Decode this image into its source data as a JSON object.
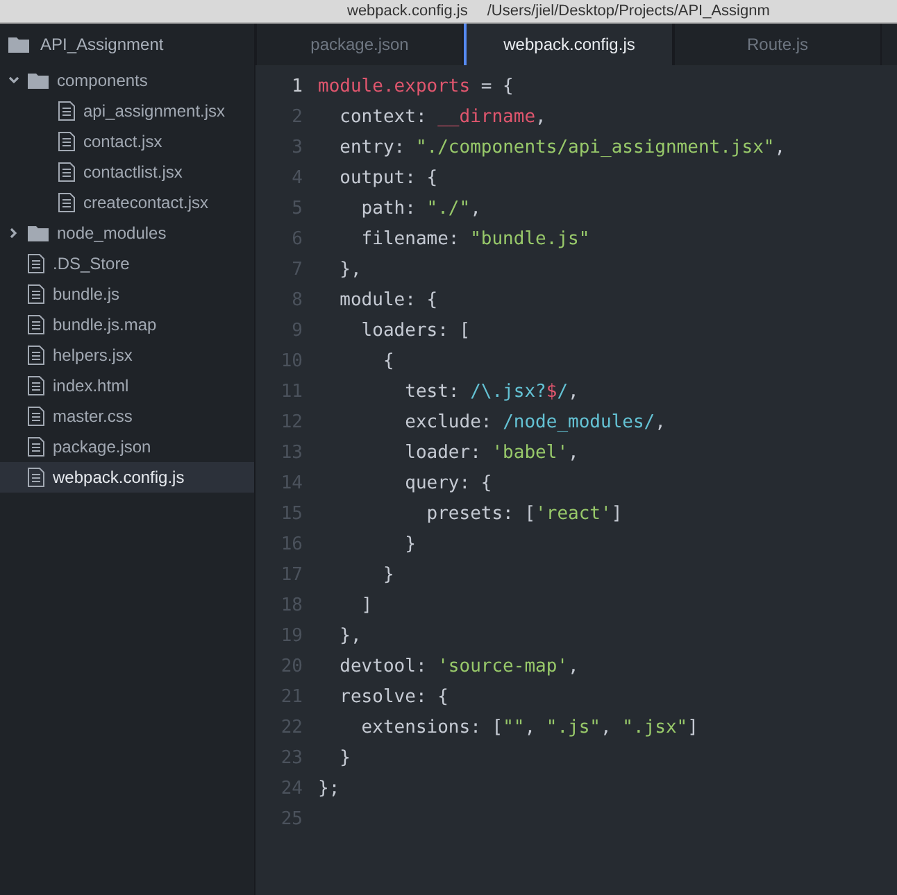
{
  "window": {
    "title": "webpack.config.js",
    "path": "/Users/jiel/Desktop/Projects/API_Assignm"
  },
  "sidebar": {
    "root": "API_Assignment",
    "items": [
      {
        "name": "components",
        "kind": "folder",
        "expanded": true,
        "selected": false,
        "children": [
          {
            "name": "api_assignment.jsx",
            "kind": "file",
            "selected": false
          },
          {
            "name": "contact.jsx",
            "kind": "file",
            "selected": false
          },
          {
            "name": "contactlist.jsx",
            "kind": "file",
            "selected": false
          },
          {
            "name": "createcontact.jsx",
            "kind": "file",
            "selected": false
          }
        ]
      },
      {
        "name": "node_modules",
        "kind": "folder",
        "expanded": false,
        "selected": false
      },
      {
        "name": ".DS_Store",
        "kind": "file",
        "selected": false
      },
      {
        "name": "bundle.js",
        "kind": "file",
        "selected": false
      },
      {
        "name": "bundle.js.map",
        "kind": "file",
        "selected": false
      },
      {
        "name": "helpers.jsx",
        "kind": "file",
        "selected": false
      },
      {
        "name": "index.html",
        "kind": "file",
        "selected": false
      },
      {
        "name": "master.css",
        "kind": "file",
        "selected": false
      },
      {
        "name": "package.json",
        "kind": "file",
        "selected": false
      },
      {
        "name": "webpack.config.js",
        "kind": "file",
        "selected": true
      }
    ]
  },
  "tabs": [
    {
      "label": "package.json",
      "selected": false
    },
    {
      "label": "webpack.config.js",
      "selected": true
    },
    {
      "label": "Route.js",
      "selected": false
    }
  ],
  "editor": {
    "lines": [
      {
        "number": "1",
        "current": true,
        "tokens": [
          {
            "text": "module.exports",
            "kind": "var"
          },
          {
            "text": " = {",
            "kind": "plain"
          }
        ]
      },
      {
        "number": "2",
        "current": false,
        "tokens": [
          {
            "text": "  context: ",
            "kind": "plain"
          },
          {
            "text": "__dirname",
            "kind": "var"
          },
          {
            "text": ",",
            "kind": "plain"
          }
        ]
      },
      {
        "number": "3",
        "current": false,
        "tokens": [
          {
            "text": "  entry: ",
            "kind": "plain"
          },
          {
            "text": "\"./components/api_assignment.jsx\"",
            "kind": "string"
          },
          {
            "text": ",",
            "kind": "plain"
          }
        ]
      },
      {
        "number": "4",
        "current": false,
        "tokens": [
          {
            "text": "  output: {",
            "kind": "plain"
          }
        ]
      },
      {
        "number": "5",
        "current": false,
        "tokens": [
          {
            "text": "    path: ",
            "kind": "plain"
          },
          {
            "text": "\"./\"",
            "kind": "string"
          },
          {
            "text": ",",
            "kind": "plain"
          }
        ]
      },
      {
        "number": "6",
        "current": false,
        "tokens": [
          {
            "text": "    filename: ",
            "kind": "plain"
          },
          {
            "text": "\"bundle.js\"",
            "kind": "string"
          }
        ]
      },
      {
        "number": "7",
        "current": false,
        "tokens": [
          {
            "text": "  },",
            "kind": "plain"
          }
        ]
      },
      {
        "number": "8",
        "current": false,
        "tokens": [
          {
            "text": "  module: {",
            "kind": "plain"
          }
        ]
      },
      {
        "number": "9",
        "current": false,
        "tokens": [
          {
            "text": "    loaders: [",
            "kind": "plain"
          }
        ]
      },
      {
        "number": "10",
        "current": false,
        "tokens": [
          {
            "text": "      {",
            "kind": "plain"
          }
        ]
      },
      {
        "number": "11",
        "current": false,
        "tokens": [
          {
            "text": "        test: ",
            "kind": "plain"
          },
          {
            "text": "/\\.jsx?",
            "kind": "regex"
          },
          {
            "text": "$",
            "kind": "var"
          },
          {
            "text": "/",
            "kind": "regex"
          },
          {
            "text": ",",
            "kind": "plain"
          }
        ]
      },
      {
        "number": "12",
        "current": false,
        "tokens": [
          {
            "text": "        exclude: ",
            "kind": "plain"
          },
          {
            "text": "/node_modules/",
            "kind": "regex"
          },
          {
            "text": ",",
            "kind": "plain"
          }
        ]
      },
      {
        "number": "13",
        "current": false,
        "tokens": [
          {
            "text": "        loader: ",
            "kind": "plain"
          },
          {
            "text": "'babel'",
            "kind": "string"
          },
          {
            "text": ",",
            "kind": "plain"
          }
        ]
      },
      {
        "number": "14",
        "current": false,
        "tokens": [
          {
            "text": "        query: {",
            "kind": "plain"
          }
        ]
      },
      {
        "number": "15",
        "current": false,
        "tokens": [
          {
            "text": "          presets: [",
            "kind": "plain"
          },
          {
            "text": "'react'",
            "kind": "string"
          },
          {
            "text": "]",
            "kind": "plain"
          }
        ]
      },
      {
        "number": "16",
        "current": false,
        "tokens": [
          {
            "text": "        }",
            "kind": "plain"
          }
        ]
      },
      {
        "number": "17",
        "current": false,
        "tokens": [
          {
            "text": "      }",
            "kind": "plain"
          }
        ]
      },
      {
        "number": "18",
        "current": false,
        "tokens": [
          {
            "text": "    ]",
            "kind": "plain"
          }
        ]
      },
      {
        "number": "19",
        "current": false,
        "tokens": [
          {
            "text": "  },",
            "kind": "plain"
          }
        ]
      },
      {
        "number": "20",
        "current": false,
        "tokens": [
          {
            "text": "  devtool: ",
            "kind": "plain"
          },
          {
            "text": "'source-map'",
            "kind": "string"
          },
          {
            "text": ",",
            "kind": "plain"
          }
        ]
      },
      {
        "number": "21",
        "current": false,
        "tokens": [
          {
            "text": "  resolve: {",
            "kind": "plain"
          }
        ]
      },
      {
        "number": "22",
        "current": false,
        "tokens": [
          {
            "text": "    extensions: [",
            "kind": "plain"
          },
          {
            "text": "\"\"",
            "kind": "string"
          },
          {
            "text": ", ",
            "kind": "plain"
          },
          {
            "text": "\".js\"",
            "kind": "string"
          },
          {
            "text": ", ",
            "kind": "plain"
          },
          {
            "text": "\".jsx\"",
            "kind": "string"
          },
          {
            "text": "]",
            "kind": "plain"
          }
        ]
      },
      {
        "number": "23",
        "current": false,
        "tokens": [
          {
            "text": "  }",
            "kind": "plain"
          }
        ]
      },
      {
        "number": "24",
        "current": false,
        "tokens": [
          {
            "text": "};",
            "kind": "plain"
          }
        ]
      },
      {
        "number": "25",
        "current": false
      }
    ]
  }
}
